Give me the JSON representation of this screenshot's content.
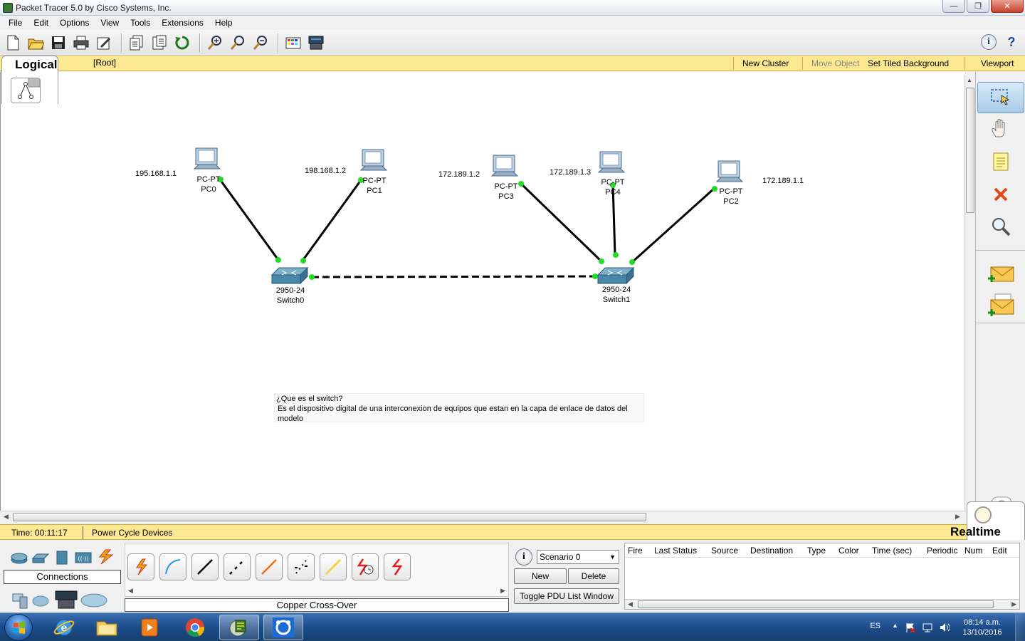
{
  "window": {
    "title": "Packet Tracer 5.0 by Cisco Systems, Inc."
  },
  "menu": [
    "File",
    "Edit",
    "Options",
    "View",
    "Tools",
    "Extensions",
    "Help"
  ],
  "logicalbar": {
    "tab": "Logical",
    "root": "[Root]",
    "new_cluster": "New Cluster",
    "move_object": "Move Object",
    "set_tiled_background": "Set Tiled Background",
    "viewport": "Viewport"
  },
  "devices": {
    "pc0": {
      "type": "PC-PT",
      "name": "PC0",
      "ip": "195.168.1.1"
    },
    "pc1": {
      "type": "PC-PT",
      "name": "PC1",
      "ip": "198.168.1.2"
    },
    "pc3": {
      "type": "PC-PT",
      "name": "PC3",
      "ip": "172.189.1.2"
    },
    "pc4": {
      "type": "PC-PT",
      "name": "PC4",
      "ip": "172.189.1.3"
    },
    "pc2": {
      "type": "PC-PT",
      "name": "PC2",
      "ip": "172.189.1.1"
    },
    "switch0": {
      "type": "2950-24",
      "name": "Switch0"
    },
    "switch1": {
      "type": "2950-24",
      "name": "Switch1"
    }
  },
  "note": {
    "line1": "¿Que es el switch?",
    "line2": "Es el dispositivo digital de una interconexion de equipos que estan en la capa de enlace de datos del modelo"
  },
  "statusbar": {
    "time": "Time: 00:11:17",
    "power_cycle": "Power Cycle Devices",
    "mode": "Realtime"
  },
  "bottom": {
    "category": "Connections",
    "connection_name": "Copper Cross-Over",
    "scenario": "Scenario 0",
    "new": "New",
    "delete": "Delete",
    "toggle_pdu": "Toggle PDU List Window",
    "pdu_columns": [
      "Fire",
      "Last Status",
      "Source",
      "Destination",
      "Type",
      "Color",
      "Time (sec)",
      "Periodic",
      "Num",
      "Edit"
    ]
  },
  "taskbar": {
    "lang": "ES",
    "time": "08:14 a.m.",
    "date": "13/10/2016"
  },
  "colors": {
    "yellow_bar": "#fbe891",
    "link_light": "#22dd22",
    "taskbar": "#1d4c8a"
  }
}
